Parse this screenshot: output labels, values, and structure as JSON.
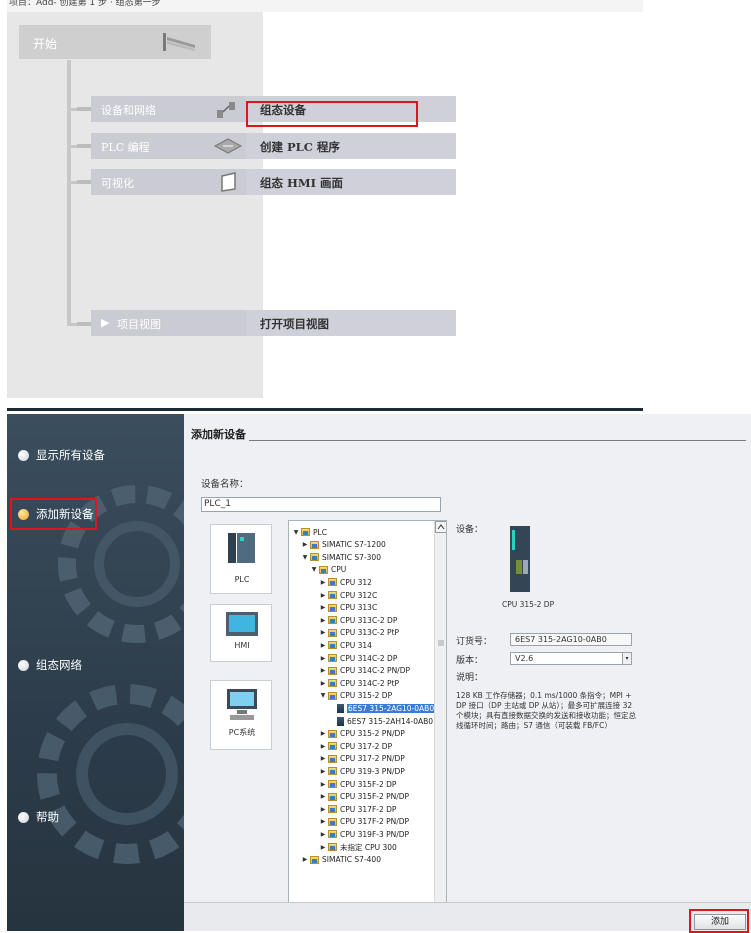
{
  "top": {
    "header_text": "项目：Add- 创建第 1 步 · 组态第一步",
    "start_label": "开始",
    "items": [
      {
        "left": "设备和网络",
        "right": "组态设备"
      },
      {
        "left": "PLC 编程",
        "right": "创建 PLC 程序"
      },
      {
        "left": "可视化",
        "right": "组态 HMI 画面"
      },
      {
        "left": "项目视图",
        "right": "打开项目视图"
      }
    ]
  },
  "bottom": {
    "nav": [
      {
        "label": "显示所有设备",
        "active": false
      },
      {
        "label": "添加新设备",
        "active": true
      },
      {
        "label": "组态网络",
        "active": false
      },
      {
        "label": "帮助",
        "active": false
      }
    ],
    "title": "添加新设备",
    "device_name_label": "设备名称：",
    "device_name_value": "PLC_1",
    "tiles": [
      "PLC",
      "HMI",
      "PC系统"
    ],
    "tree": [
      {
        "label": "PLC",
        "depth": 0,
        "toggle": "▼",
        "icon": "folder"
      },
      {
        "label": "SIMATIC S7-1200",
        "depth": 1,
        "toggle": "▶",
        "icon": "folder"
      },
      {
        "label": "SIMATIC S7-300",
        "depth": 1,
        "toggle": "▼",
        "icon": "folder"
      },
      {
        "label": "CPU",
        "depth": 2,
        "toggle": "▼",
        "icon": "folder"
      },
      {
        "label": "CPU 312",
        "depth": 3,
        "toggle": "▶",
        "icon": "folder"
      },
      {
        "label": "CPU 312C",
        "depth": 3,
        "toggle": "▶",
        "icon": "folder"
      },
      {
        "label": "CPU 313C",
        "depth": 3,
        "toggle": "▶",
        "icon": "folder"
      },
      {
        "label": "CPU 313C-2 DP",
        "depth": 3,
        "toggle": "▶",
        "icon": "folder"
      },
      {
        "label": "CPU 313C-2 PtP",
        "depth": 3,
        "toggle": "▶",
        "icon": "folder"
      },
      {
        "label": "CPU 314",
        "depth": 3,
        "toggle": "▶",
        "icon": "folder"
      },
      {
        "label": "CPU 314C-2 DP",
        "depth": 3,
        "toggle": "▶",
        "icon": "folder"
      },
      {
        "label": "CPU 314C-2 PN/DP",
        "depth": 3,
        "toggle": "▶",
        "icon": "folder"
      },
      {
        "label": "CPU 314C-2 PtP",
        "depth": 3,
        "toggle": "▶",
        "icon": "folder"
      },
      {
        "label": "CPU 315-2 DP",
        "depth": 3,
        "toggle": "▼",
        "icon": "folder"
      },
      {
        "label": "6ES7 315-2AG10-0AB0",
        "depth": 4,
        "toggle": "",
        "icon": "module",
        "selected": true
      },
      {
        "label": "6ES7 315-2AH14-0AB0",
        "depth": 4,
        "toggle": "",
        "icon": "module"
      },
      {
        "label": "CPU 315-2 PN/DP",
        "depth": 3,
        "toggle": "▶",
        "icon": "folder"
      },
      {
        "label": "CPU 317-2 DP",
        "depth": 3,
        "toggle": "▶",
        "icon": "folder"
      },
      {
        "label": "CPU 317-2 PN/DP",
        "depth": 3,
        "toggle": "▶",
        "icon": "folder"
      },
      {
        "label": "CPU 319-3 PN/DP",
        "depth": 3,
        "toggle": "▶",
        "icon": "folder"
      },
      {
        "label": "CPU 315F-2 DP",
        "depth": 3,
        "toggle": "▶",
        "icon": "folder"
      },
      {
        "label": "CPU 315F-2 PN/DP",
        "depth": 3,
        "toggle": "▶",
        "icon": "folder"
      },
      {
        "label": "CPU 317F-2 DP",
        "depth": 3,
        "toggle": "▶",
        "icon": "folder"
      },
      {
        "label": "CPU 317F-2 PN/DP",
        "depth": 3,
        "toggle": "▶",
        "icon": "folder"
      },
      {
        "label": "CPU 319F-3 PN/DP",
        "depth": 3,
        "toggle": "▶",
        "icon": "folder"
      },
      {
        "label": "未指定 CPU 300",
        "depth": 3,
        "toggle": "▶",
        "icon": "folder"
      },
      {
        "label": "SIMATIC S7-400",
        "depth": 1,
        "toggle": "▶",
        "icon": "folder"
      }
    ],
    "info": {
      "device_label": "设备：",
      "device_model": "CPU 315-2 DP",
      "order_label": "订货号：",
      "order_value": "6ES7 315-2AG10-0AB0",
      "version_label": "版本：",
      "version_value": "V2.6",
      "desc_label": "说明：",
      "desc_text": "128 KB 工作存储器；0.1 ms/1000 条指令；MPI + DP 接口（DP 主站或 DP 从站）；最多可扩展连接 32 个模块；具有直接数据交换的发送和接收功能；恒定总线循环时间；路由；S7 通信（可装载 FB/FC）"
    },
    "add_button": "添加"
  }
}
